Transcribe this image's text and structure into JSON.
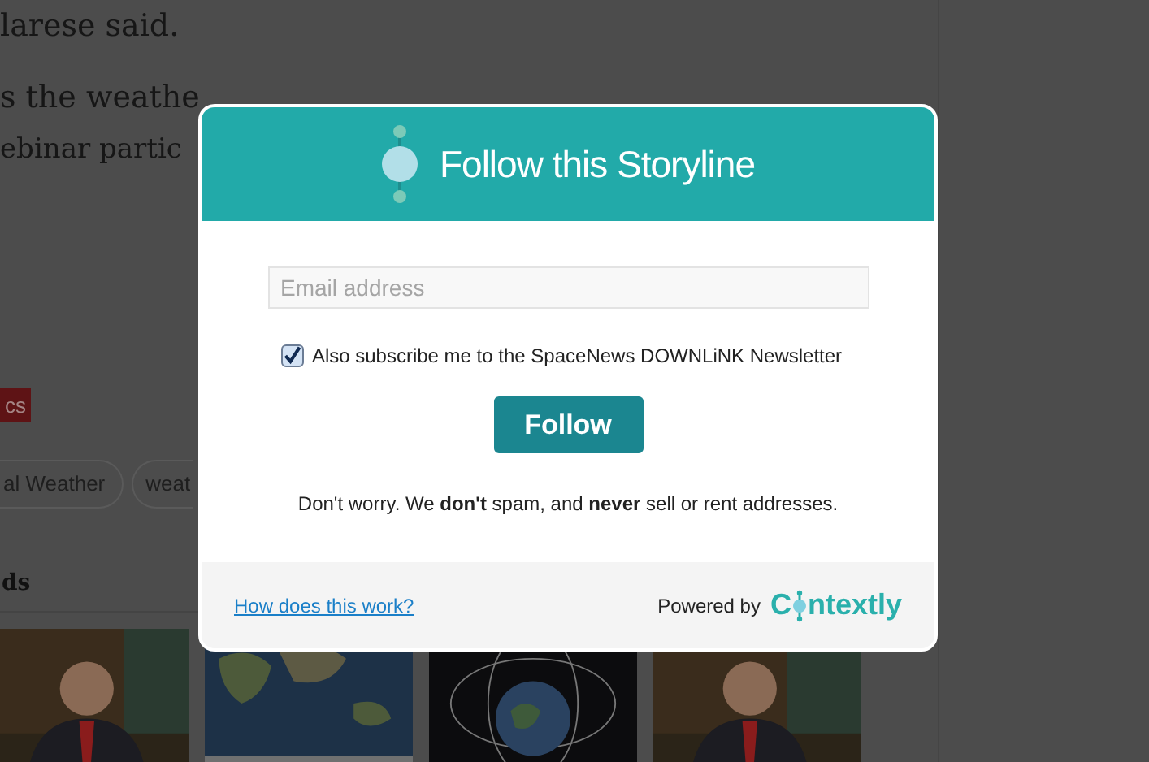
{
  "article": {
    "lines": [
      "larese said.",
      "s the weathe",
      "ebinar partic"
    ]
  },
  "category_tag": "cs",
  "tags": [
    "al Weather",
    "weat"
  ],
  "related_heading": "ds",
  "related_images": [
    {
      "kind": "picture"
    },
    {
      "kind": "picture"
    },
    {
      "kind": "picture"
    },
    {
      "kind": "picture"
    }
  ],
  "modal": {
    "title": "Follow this Storyline",
    "email_field": {
      "placeholder": "Email address"
    },
    "newsletter": {
      "label": "Also subscribe me to the SpaceNews DOWNLiNK Newsletter",
      "checked": true
    },
    "follow_button": "Follow",
    "note": "Don't worry. We **don't** spam, and **never** sell or rent addresses.",
    "help_link": "How does this work?",
    "powered_by": "Powered by",
    "logo": {
      "before": "C",
      "after": "ntextly"
    }
  }
}
